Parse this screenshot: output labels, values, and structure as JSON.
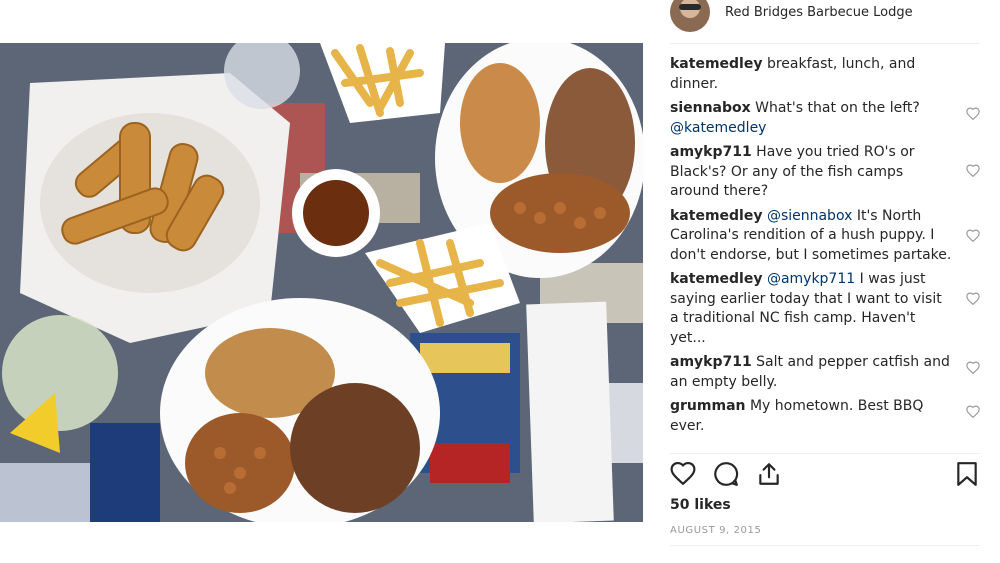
{
  "post": {
    "account_name": "Red Bridges Barbecue Lodge",
    "likes": "50 likes",
    "date": "AUGUST 9, 2015"
  },
  "comments": [
    {
      "user": "katemedley",
      "text": "breakfast, lunch, and dinner.",
      "mention": ""
    },
    {
      "user": "siennabox",
      "text": "What's that on the left?",
      "mention": "@katemedley",
      "after": ""
    },
    {
      "user": "amykp711",
      "text": "Have you tried RO's or Black's? Or any of the fish camps around there?",
      "mention": ""
    },
    {
      "user": "katemedley",
      "mention": "@siennabox",
      "after": "It's North Carolina's rendition of a hush puppy. I don't endorse, but I sometimes partake."
    },
    {
      "user": "katemedley",
      "mention": "@amykp711",
      "after": "I was just saying earlier today that I want to visit a traditional NC fish camp. Haven't yet..."
    },
    {
      "user": "amykp711",
      "text": "Salt and pepper catfish and an empty belly.",
      "mention": ""
    },
    {
      "user": "grumman",
      "text": "My hometown. Best BBQ ever.",
      "mention": ""
    }
  ],
  "icons": [
    "avatar",
    "heart-icon",
    "comment-icon",
    "share-icon",
    "bookmark-icon",
    "comment-like-icon"
  ],
  "colors": {
    "text": "#262626",
    "mention": "#003569",
    "meta": "#999999",
    "separator": "#efefef"
  }
}
